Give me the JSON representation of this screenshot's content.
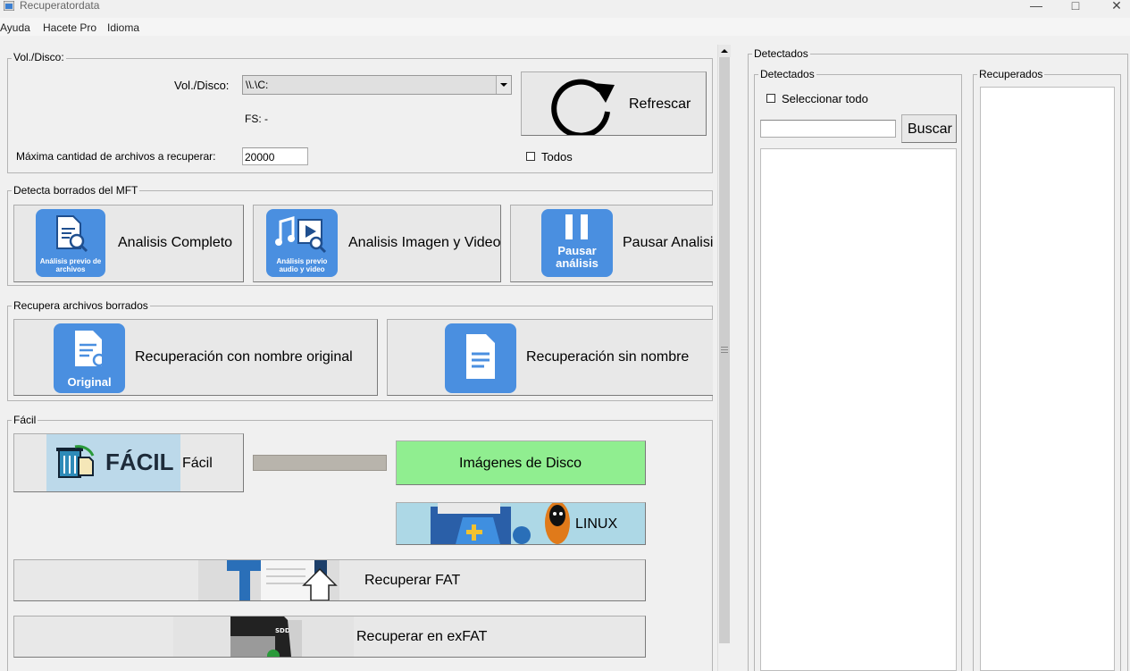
{
  "window": {
    "title": "Recuperatordata"
  },
  "menu": [
    "Ayuda",
    "Hacete Pro",
    "Idioma"
  ],
  "vol_group": {
    "legend": "Vol./Disco:",
    "vol_label": "Vol./Disco:",
    "vol_value": "\\\\.\\C:",
    "fs_label": "FS: -",
    "max_label": "Máxima cantidad de archivos a recuperar:",
    "max_value": "20000",
    "refresh_label": "Refrescar",
    "todos_label": "Todos"
  },
  "mft_group": {
    "legend": "Detecta borrados del MFT",
    "btn_full": "Analisis Completo",
    "btn_full_icon_caption": "Análisis previo de archivos",
    "btn_media": "Analisis Imagen y Video",
    "btn_media_icon_caption": "Análisis previo audio y video",
    "btn_pause": "Pausar Analisi",
    "btn_pause_icon_caption": "Pausar análisis"
  },
  "recover_group": {
    "legend": "Recupera archivos borrados",
    "btn_original": "Recuperación con nombre original",
    "btn_original_icon_caption": "Original",
    "btn_noname": "Recuperación sin nombre"
  },
  "easy_group": {
    "legend": "Fácil",
    "btn_easy": "Fácil",
    "btn_easy_icon_caption": "FÁCIL",
    "btn_images": "Imágenes de Disco",
    "btn_linux": "LINUX",
    "btn_fat": "Recuperar FAT",
    "btn_exfat": "Recuperar en exFAT",
    "sdd_caption": "SDD",
    "progress": 0
  },
  "right_panel": {
    "legend": "Detectados",
    "detected_legend": "Detectados",
    "select_all": "Seleccionar todo",
    "search_button": "Buscar",
    "search_value": "",
    "recovered_legend": "Recuperados"
  },
  "colors": {
    "tile_blue": "#4a8fe0",
    "images_button": "#90ee90",
    "linux_button": "#add8e6",
    "progress_track": "#b8b4ac"
  }
}
